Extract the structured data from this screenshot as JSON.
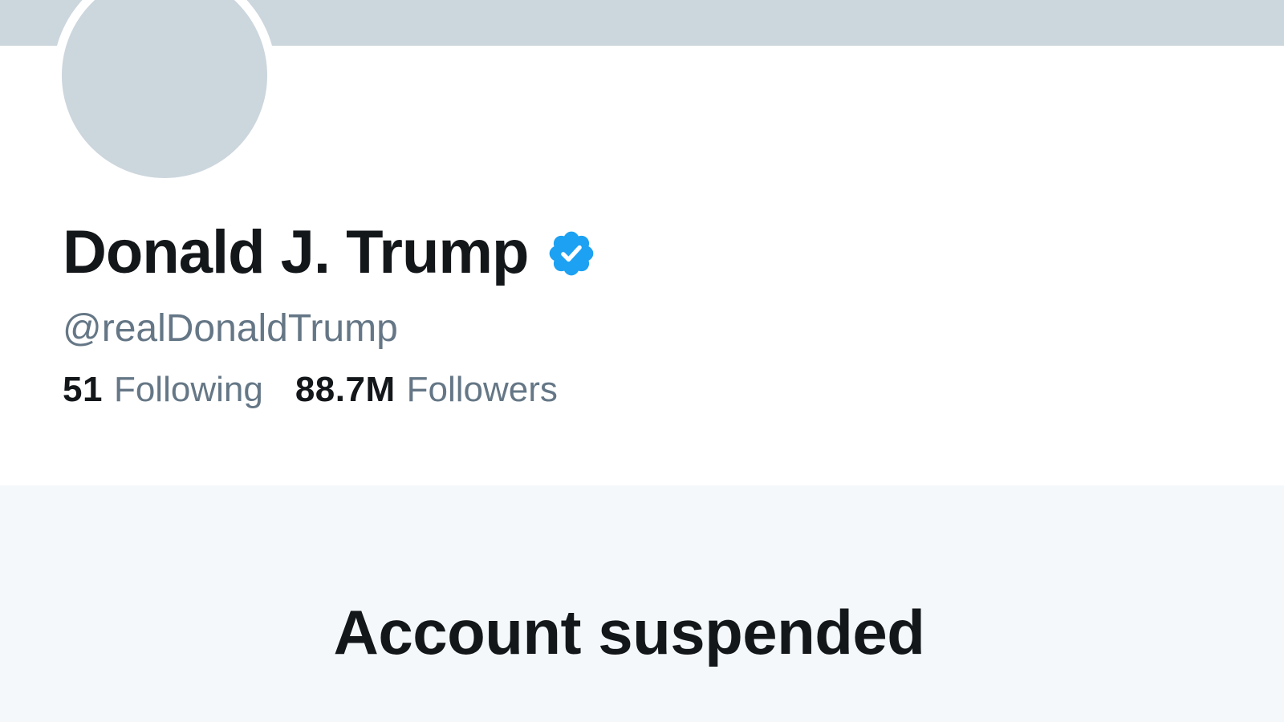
{
  "profile": {
    "display_name": "Donald J. Trump",
    "verified_badge_icon": "verified-badge-icon",
    "handle": "@realDonaldTrump"
  },
  "stats": {
    "following_count": "51",
    "following_label": "Following",
    "followers_count": "88.7M",
    "followers_label": "Followers"
  },
  "notice": {
    "title": "Account suspended"
  },
  "colors": {
    "banner": "#ccd6dd",
    "avatar_placeholder": "#ccd6dd",
    "verified_blue": "#1da1f2",
    "text_primary": "#14171a",
    "text_secondary": "#657786",
    "suspended_background": "#f5f8fa"
  }
}
